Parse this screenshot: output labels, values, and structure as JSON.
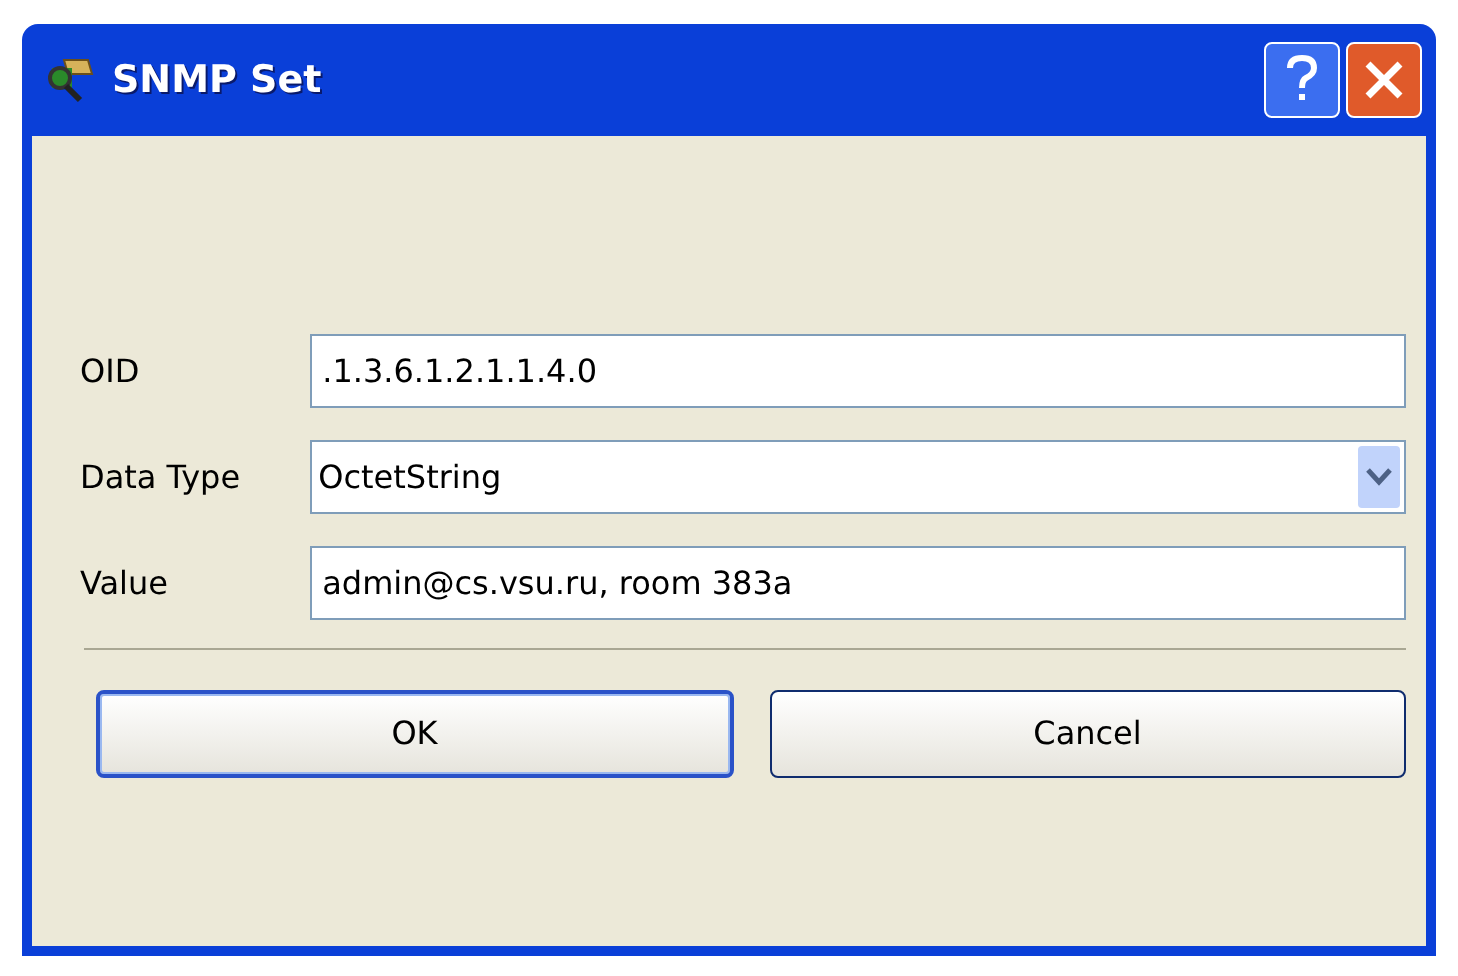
{
  "window": {
    "title": "SNMP Set"
  },
  "fields": [
    {
      "label": "OID",
      "kind": "text",
      "value": ".1.3.6.1.2.1.1.4.0"
    },
    {
      "label": "Data Type",
      "kind": "dropdown",
      "value": "OctetString"
    },
    {
      "label": "Value",
      "kind": "text",
      "value": "admin@cs.vsu.ru, room 383a"
    }
  ],
  "buttons": [
    {
      "label": "OK",
      "default": true
    },
    {
      "label": "Cancel",
      "default": false
    }
  ]
}
